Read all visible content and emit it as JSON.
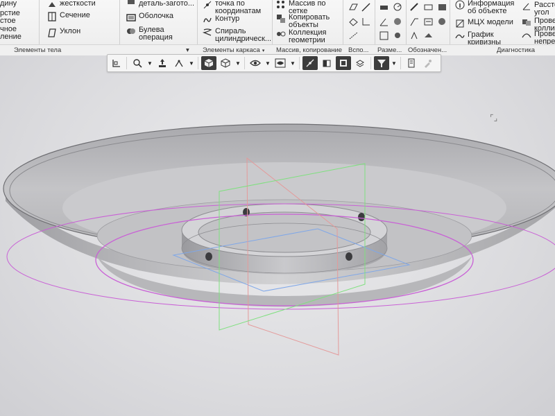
{
  "ribbon": {
    "col0": [
      "дину",
      "рстие\nстое",
      "чное\nление"
    ],
    "col1": [
      "жесткости",
      "Сечение",
      "Уклон"
    ],
    "col2": [
      "деталь-загото...",
      "Оболочка",
      "Булева\nоперация"
    ],
    "col3": [
      "точка по\nкоординатам",
      "Контур",
      "Спираль\nцилиндрическ..."
    ],
    "col4": [
      "Массив по\nсетке",
      "Копировать\nобъекты",
      "Коллекция\nгеометрии"
    ],
    "col6": [
      "Информация\nоб объекте",
      "МЦХ модели",
      "График\nкривизны"
    ],
    "col7": [
      "Рассто\nугол",
      "Провер\nколлизи",
      "Провер\nнепреры"
    ],
    "group_labels": [
      "Элементы тела",
      "Элементы каркаса",
      "Массив, копирование",
      "Вспо...",
      "Разме...",
      "Обозначен...",
      "Диагностика"
    ]
  },
  "viewport": {
    "corner_mark": "⌜⌟"
  },
  "colors": {
    "ribbon_bg": "#f0f0f0",
    "model_fill": "#c9c9cb",
    "plane_green": "#7ee07e",
    "plane_red": "#e49a9a",
    "plane_blue": "#7fa7e8",
    "circle_magenta": "#c960d6"
  }
}
